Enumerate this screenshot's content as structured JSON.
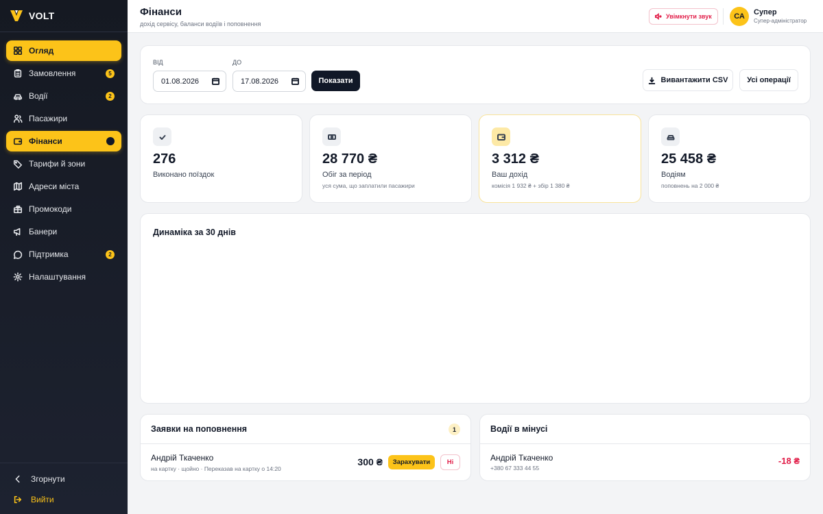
{
  "brand": {
    "name": "VOLT",
    "accent": "#fcc319"
  },
  "sidebar": {
    "items": [
      {
        "label": "Огляд",
        "icon": "grid-icon",
        "active": true
      },
      {
        "label": "Замовлення",
        "icon": "clipboard-icon",
        "badge": "5"
      },
      {
        "label": "Водії",
        "icon": "car-icon",
        "badge": "2"
      },
      {
        "label": "Пасажири",
        "icon": "users-icon"
      },
      {
        "label": "Фінанси",
        "icon": "wallet-icon",
        "active": true
      },
      {
        "label": "Тарифи й зони",
        "icon": "tag-icon"
      },
      {
        "label": "Адреси міста",
        "icon": "map-icon"
      },
      {
        "label": "Промокоди",
        "icon": "gift-icon"
      },
      {
        "label": "Банери",
        "icon": "megaphone-icon"
      },
      {
        "label": "Підтримка",
        "icon": "chat-icon",
        "badge": "2"
      },
      {
        "label": "Налаштування",
        "icon": "gear-icon"
      }
    ],
    "collapse_label": "Згорнути",
    "logout_label": "Вийти"
  },
  "header": {
    "title": "Фінанси",
    "subtitle": "дохід сервісу, баланси водіїв і поповнення",
    "sound_label": "Увімкнути звук",
    "user": {
      "initials": "СА",
      "name": "Супер",
      "role": "Супер-адміністратор"
    }
  },
  "filter": {
    "from_label": "ВІД",
    "from_value": "01.08.2026",
    "to_label": "ДО",
    "to_value": "17.08.2026",
    "show_label": "Показати",
    "csv_label": "Вивантажити CSV",
    "ops_label": "Усі операції"
  },
  "stats": [
    {
      "icon": "check-icon",
      "value": "276",
      "label": "Виконано поїздок",
      "sub": ""
    },
    {
      "icon": "banknote-icon",
      "value": "28 770 ₴",
      "label": "Обіг за період",
      "sub": "уся сума, що заплатили пасажири"
    },
    {
      "icon": "wallet-icon",
      "value": "3 312 ₴",
      "label": "Ваш дохід",
      "sub": "комісія 1 932 ₴ + збір 1 380 ₴"
    },
    {
      "icon": "car-icon",
      "value": "25 458 ₴",
      "label": "Водіям",
      "sub": "поповнень на 2 000 ₴"
    }
  ],
  "chart": {
    "title": "Динаміка за 30 днів"
  },
  "topups": {
    "title": "Заявки на поповнення",
    "count": "1",
    "rows": [
      {
        "name": "Андрій Ткаченко",
        "meta": "на картку · щойно · Переказав на картку о 14:20",
        "amount": "300 ₴",
        "approve_label": "Зарахувати",
        "reject_label": "Ні"
      }
    ]
  },
  "negative": {
    "title": "Водії в мінусі",
    "rows": [
      {
        "name": "Андрій Ткаченко",
        "phone": "+380 67 333 44 55",
        "amount": "-18 ₴"
      }
    ]
  },
  "colors": {
    "accent": "#fcc319",
    "danger": "#e11d48",
    "dark": "#111827"
  }
}
